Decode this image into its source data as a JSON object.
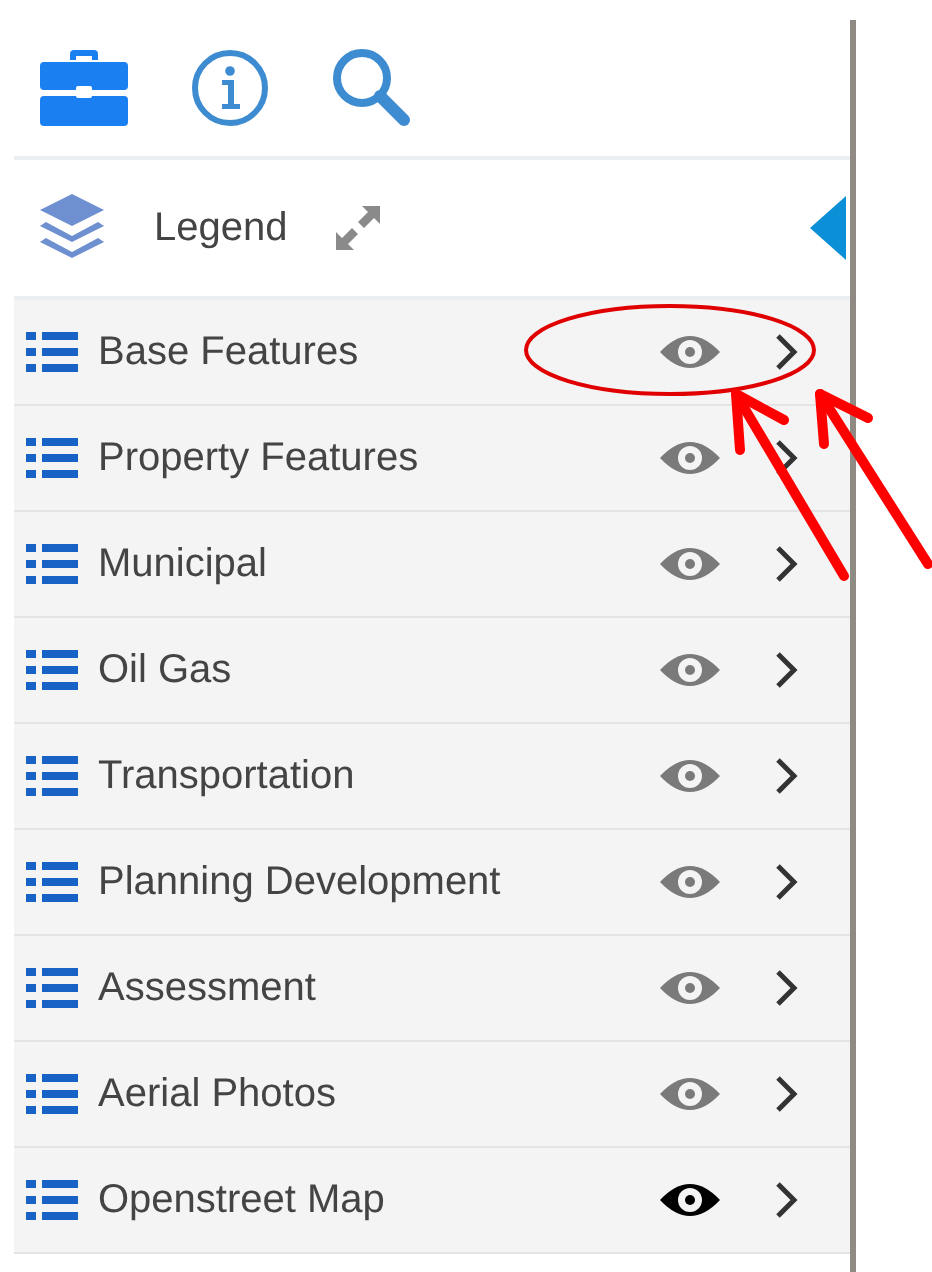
{
  "toolbar": {
    "buttons": [
      {
        "kind": "briefcase"
      },
      {
        "kind": "info"
      },
      {
        "kind": "search"
      }
    ]
  },
  "legend": {
    "title": "Legend"
  },
  "layers": [
    {
      "name": "Base Features",
      "visible": false
    },
    {
      "name": "Property Features",
      "visible": false
    },
    {
      "name": "Municipal",
      "visible": false
    },
    {
      "name": "Oil Gas",
      "visible": false
    },
    {
      "name": "Transportation",
      "visible": false
    },
    {
      "name": "Planning Development",
      "visible": false
    },
    {
      "name": "Assessment",
      "visible": false
    },
    {
      "name": "Aerial Photos",
      "visible": false
    },
    {
      "name": "Openstreet Map",
      "visible": true
    }
  ]
}
